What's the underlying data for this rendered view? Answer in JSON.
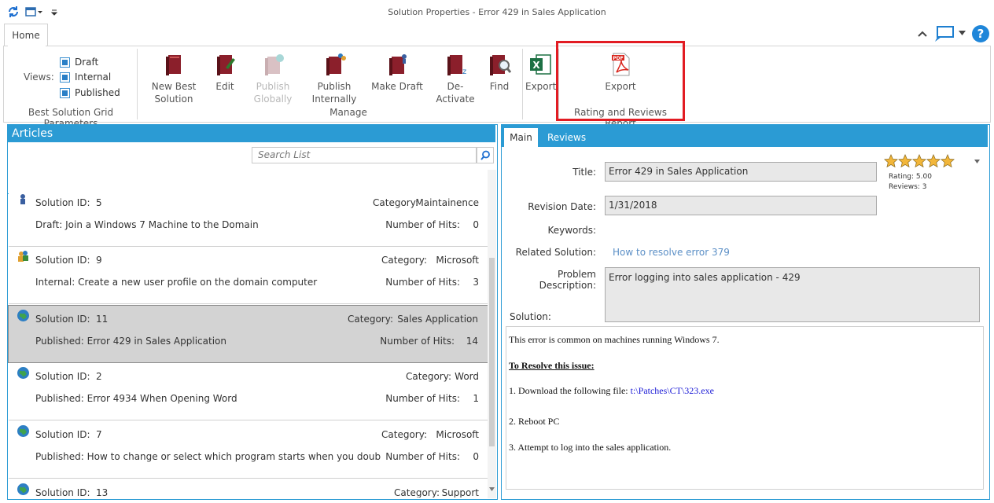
{
  "window": {
    "title": "Solution Properties -  Error 429 in Sales Application"
  },
  "ribbon": {
    "tab_home": "Home",
    "views_label": "Views:",
    "views": [
      "Draft",
      "Internal",
      "Published"
    ],
    "group_grid": "Best Solution Grid Parameters",
    "buttons": [
      {
        "line1": "New Best",
        "line2": "Solution"
      },
      {
        "line1": "Edit",
        "line2": ""
      },
      {
        "line1": "Publish",
        "line2": "Globally"
      },
      {
        "line1": "Publish",
        "line2": "Internally"
      },
      {
        "line1": "Make Draft",
        "line2": ""
      },
      {
        "line1": "De-Activate",
        "line2": ""
      },
      {
        "line1": "Find",
        "line2": ""
      },
      {
        "line1": "Export",
        "line2": ""
      }
    ],
    "group_manage": "Manage",
    "export_pdf": "Export",
    "group_report": "Rating and Reviews Report"
  },
  "articles": {
    "header": "Articles",
    "search_placeholder": "Search List",
    "rows": [
      {
        "id_label": "Solution ID:",
        "id": "5",
        "cat_label": "Category:",
        "category": "Maintainence",
        "title": "Draft: Join a Windows 7 Machine to the Domain",
        "hits_label": "Number of Hits:",
        "hits": "0"
      },
      {
        "id_label": "Solution ID:",
        "id": "9",
        "cat_label": "Category:",
        "category": "Microsoft",
        "title": "Internal: Create a new user profile on the domain computer",
        "hits_label": "Number of Hits:",
        "hits": "3"
      },
      {
        "id_label": "Solution ID:",
        "id": "11",
        "cat_label": "Category:",
        "category": "Sales Application",
        "title": "Published: Error 429 in Sales Application",
        "hits_label": "Number of Hits:",
        "hits": "14"
      },
      {
        "id_label": "Solution ID:",
        "id": "2",
        "cat_label": "Category:",
        "category": "Word",
        "title": "Published: Error 4934 When Opening Word",
        "hits_label": "Number of Hits:",
        "hits": "1"
      },
      {
        "id_label": "Solution ID:",
        "id": "7",
        "cat_label": "Category:",
        "category": "Microsoft",
        "title": "Published: How to change or select which program starts when you double-click...",
        "hits_label": "Number of Hits:",
        "hits": "0"
      },
      {
        "id_label": "Solution ID:",
        "id": "13",
        "cat_label": "Category:",
        "category": "Support"
      }
    ]
  },
  "detail": {
    "tab_main": "Main",
    "tab_reviews": "Reviews",
    "title_label": "Title:",
    "title_value": "Error 429 in Sales Application",
    "revision_label": "Revision Date:",
    "revision_value": "1/31/2018",
    "keywords_label": "Keywords:",
    "related_label": "Related Solution:",
    "related_value": "How to resolve error 379",
    "problem_label": "Problem Description:",
    "problem_value": "Error logging into sales application - 429",
    "solution_label": "Solution:",
    "rating_text": "Rating: 5.00",
    "reviews_text": "Reviews: 3",
    "rating": 5,
    "solution_body": {
      "line1": "This error is common on machines running Windows 7.",
      "heading": "To Resolve this issue: ",
      "step1_text": "1. Download the following file: ",
      "step1_link": "t:\\Patches\\CT\\323.exe",
      "step2": "2. Reboot PC",
      "step3": "3. Attempt to log into the sales application."
    }
  },
  "colors": {
    "accent": "#2b9bd4",
    "highlight": "#e21c23",
    "link": "#5b8fc6"
  }
}
